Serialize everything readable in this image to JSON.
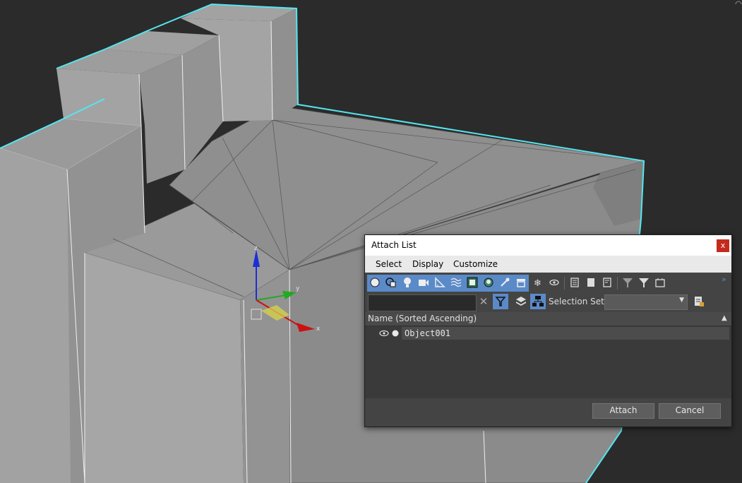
{
  "dialog": {
    "title": "Attach List",
    "close_label": "x",
    "menu": [
      "Select",
      "Display",
      "Customize"
    ],
    "search": {
      "value": "",
      "placeholder": ""
    },
    "clear_label": "✕",
    "selection_set_label": "Selection Set:",
    "selection_set_value": "",
    "list": {
      "column_header": "Name (Sorted Ascending)",
      "sort_arrow": "▲",
      "rows": [
        {
          "name": "Object001"
        }
      ]
    },
    "buttons": {
      "attach": "Attach",
      "cancel": "Cancel"
    }
  },
  "toolbar_icons": [
    "geometry-icon",
    "shapes-icon",
    "lights-icon",
    "cameras-icon",
    "helpers-icon",
    "spacewarps-icon",
    "groups-icon",
    "xrefs-icon",
    "bones-icon",
    "containers-icon",
    "frozen-icon",
    "hidden-icon",
    "all-icon",
    "none-icon",
    "invert-icon",
    "filter-icon",
    "filter-funnel-icon",
    "display-options-icon"
  ],
  "viewport": {
    "axis_labels": {
      "x": "x",
      "y": "y",
      "z": "z"
    }
  },
  "colors": {
    "accent_blue": "#5b8ac9",
    "selection_outline": "#55e6f0",
    "close_red": "#c42b1c"
  }
}
